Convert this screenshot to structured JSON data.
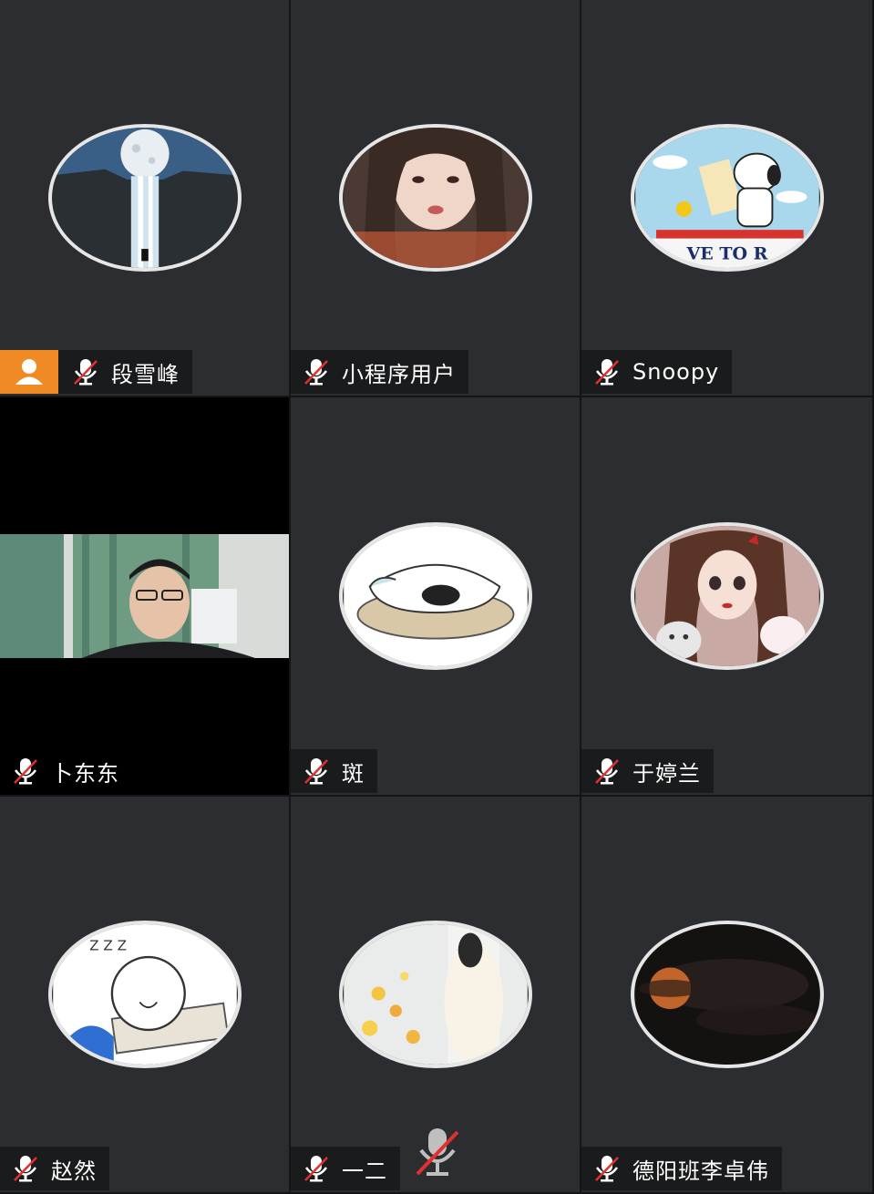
{
  "participants": [
    {
      "name": "段雪峰",
      "is_host": true,
      "mic": "muted",
      "avatar": "moon-waterfall"
    },
    {
      "name": "小程序用户",
      "mic": "muted",
      "avatar": "girl-portrait"
    },
    {
      "name": "Snoopy",
      "mic": "muted",
      "avatar": "snoopy-cartoon",
      "avatar_text": "VE TO R"
    },
    {
      "name": "卜东东",
      "mic": "muted",
      "video": "on"
    },
    {
      "name": "斑",
      "mic": "muted",
      "avatar": "sleeping-cat-sketch"
    },
    {
      "name": "于婷兰",
      "mic": "muted",
      "avatar": "anime-girl-with-cats"
    },
    {
      "name": "赵然",
      "mic": "muted",
      "avatar": "sleeping-cartoon",
      "avatar_text": "Z Z Z"
    },
    {
      "name": "一二",
      "mic": "muted",
      "avatar": "flower-photo"
    },
    {
      "name": "德阳班李卓伟",
      "mic": "muted",
      "avatar": "dark-moon"
    }
  ],
  "toolbar": {
    "center_mic": "mic-muted-icon"
  },
  "colors": {
    "tile_bg": "#2c2d30",
    "host_badge": "#f08a24",
    "mute_red": "#e03030",
    "avatar_border": "#e6e6e6"
  }
}
